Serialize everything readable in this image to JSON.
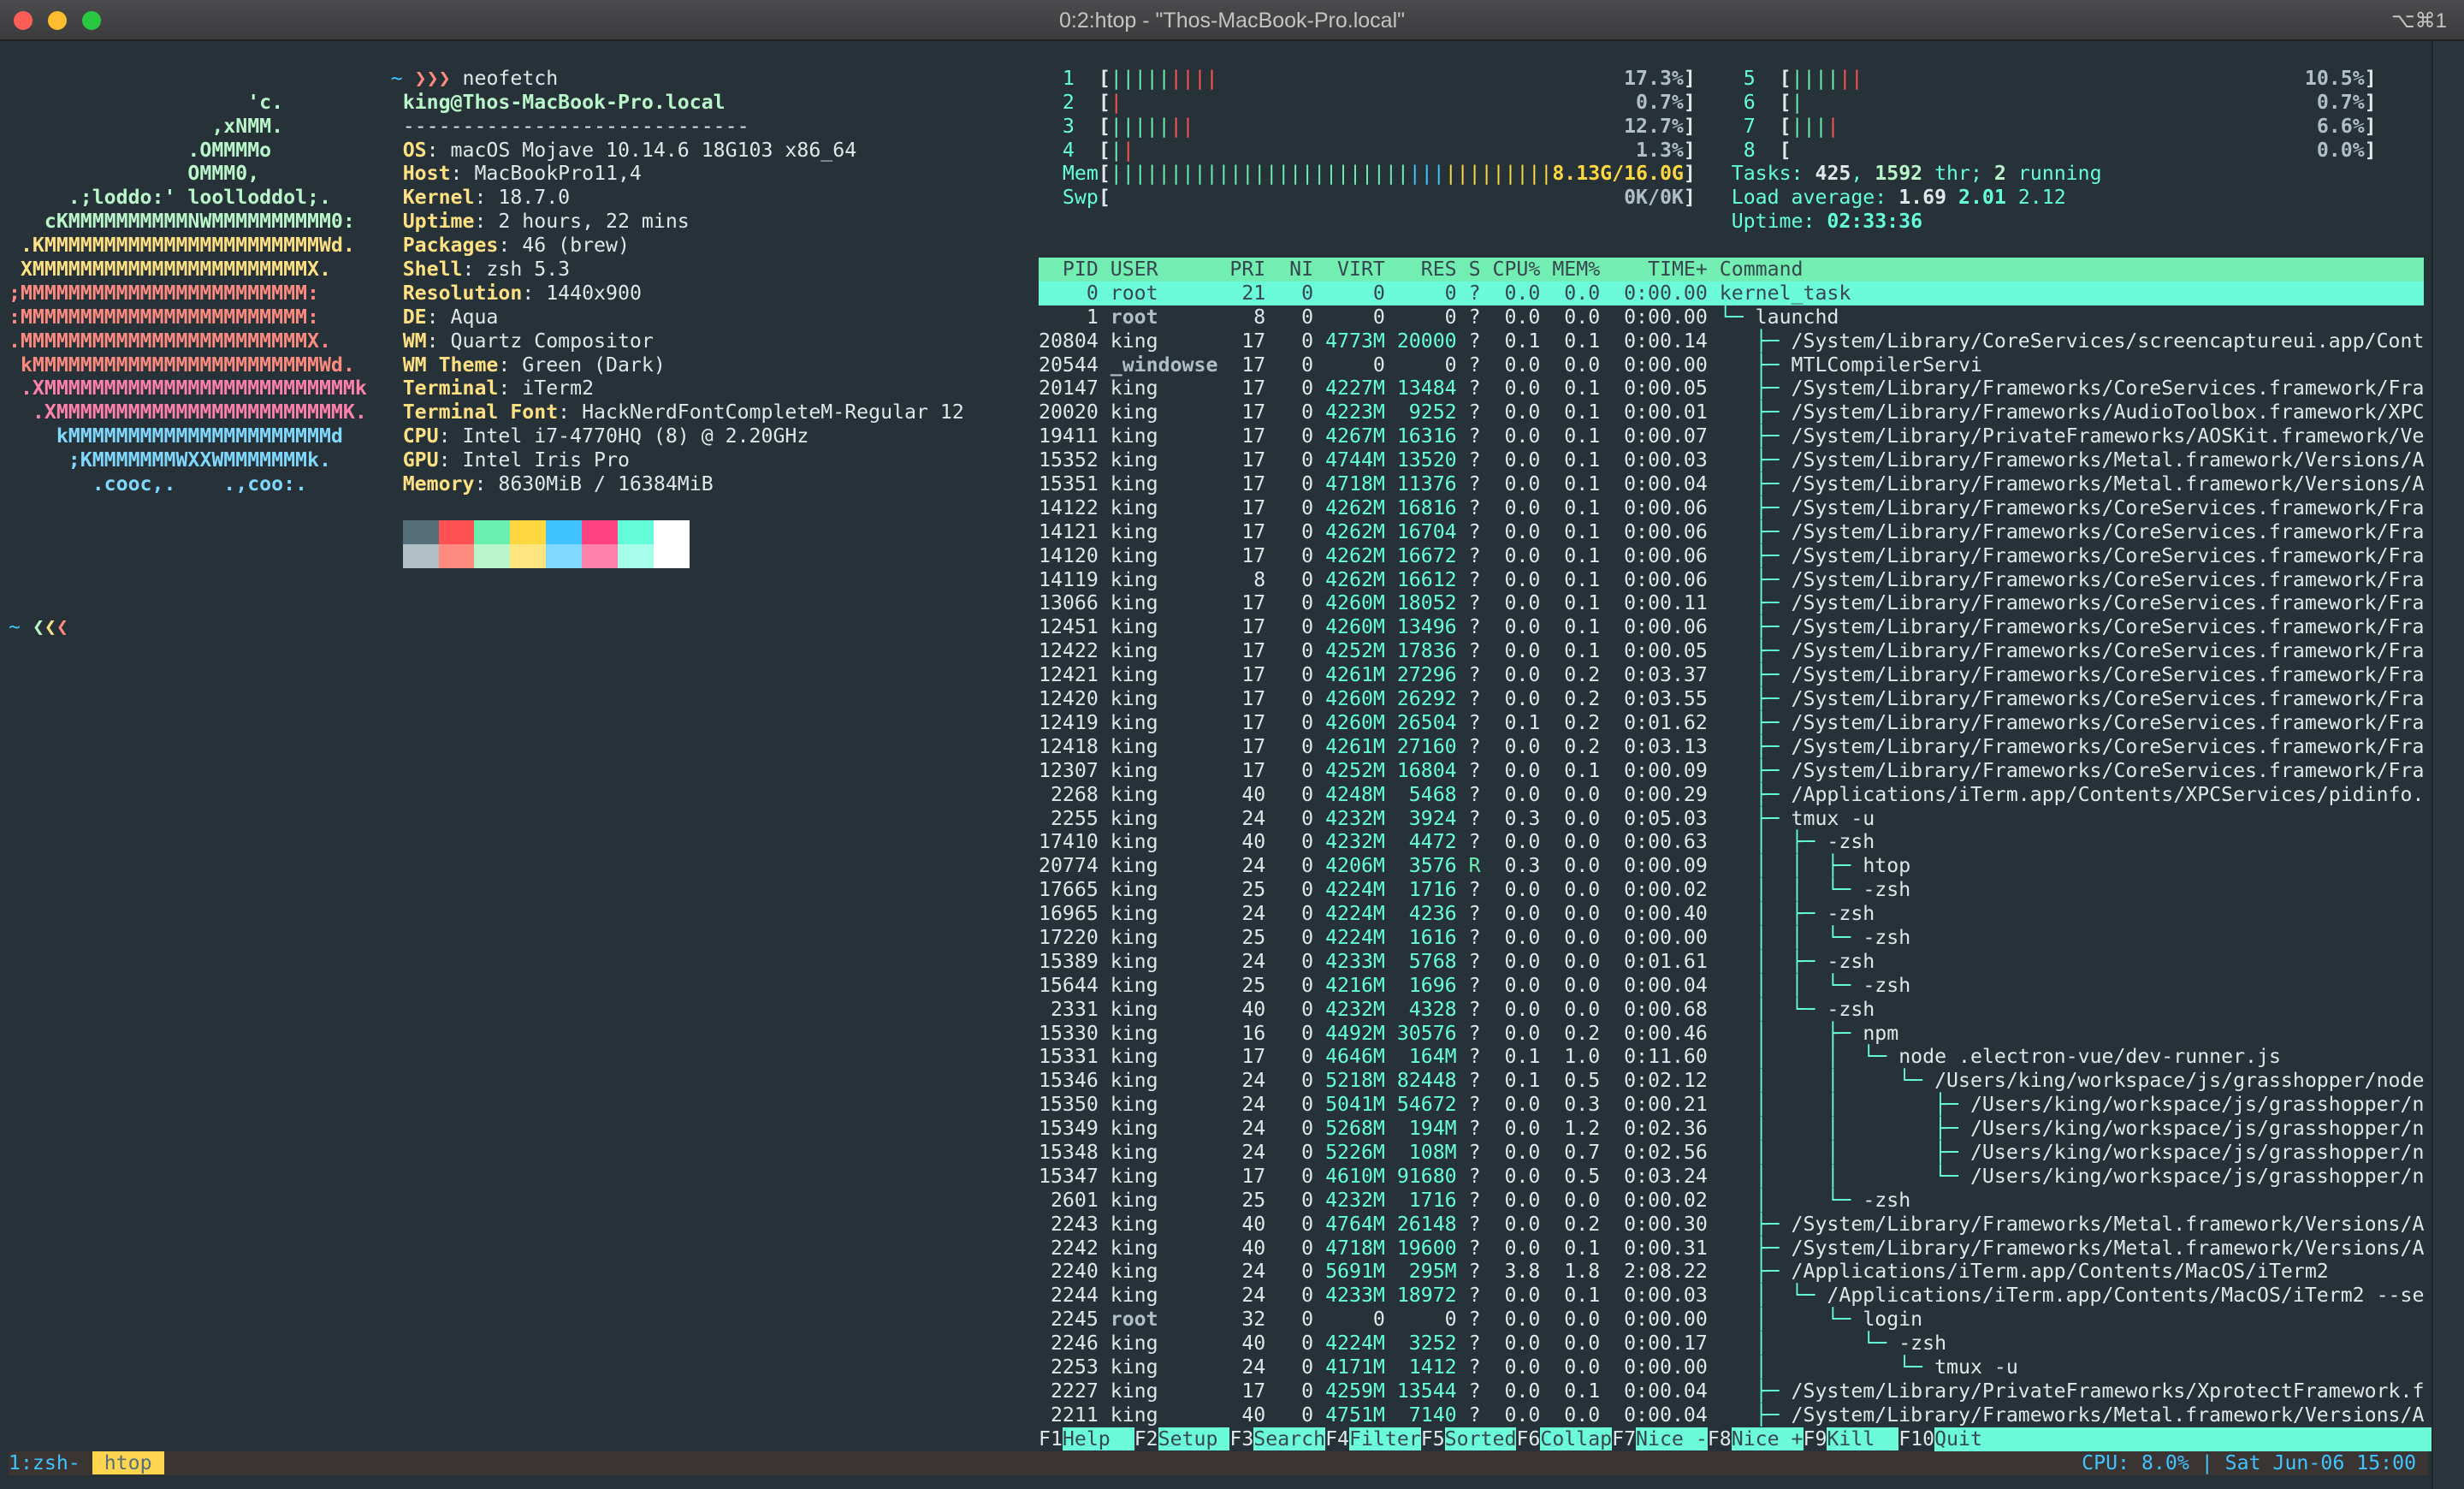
{
  "window": {
    "title": "0:2:htop - \"Thos-MacBook-Pro.local\"",
    "shortcut": "⌥⌘1",
    "traffic_lights": {
      "close": "#fd5f57",
      "minimize": "#febc2e",
      "zoom": "#28c840"
    }
  },
  "colors": {
    "background": "#263238",
    "text": "#e0e6ea",
    "teal": "#64ffda",
    "green": "#69f0ae",
    "red": "#ff5252",
    "blue": "#40c4ff",
    "yellow": "#ffd740",
    "grey": "#b0bec5",
    "header_bg": "#73eeb2",
    "selected_bg": "#6bfbd8",
    "selected_fg": "#37474f",
    "status_bg": "#3a3532",
    "label_yellow": "#ffe082",
    "host_green": "#b9f6ca"
  },
  "neofetch": {
    "prompt_tilde": "~",
    "prompt_arrows": "❯❯❯",
    "command": "neofetch",
    "user_host": "king@Thos-MacBook-Pro.local",
    "separator": "-----------------------------",
    "ascii": [
      {
        "text": "                    'c.",
        "color": "#b9f6ca"
      },
      {
        "text": "                 ,xNMM.",
        "color": "#b9f6ca"
      },
      {
        "text": "               .OMMMMo",
        "color": "#b9f6ca"
      },
      {
        "text": "               OMMM0,",
        "color": "#b9f6ca"
      },
      {
        "text": "     .;loddo:' loolloddol;.",
        "color": "#b9f6ca"
      },
      {
        "text": "   cKMMMMMMMMMMNWMMMMMMMMMM0:",
        "color": "#b9f6ca"
      },
      {
        "text": " .KMMMMMMMMMMMMMMMMMMMMMMMWd.",
        "color": "#ffe082"
      },
      {
        "text": " XMMMMMMMMMMMMMMMMMMMMMMMX.",
        "color": "#ffe082"
      },
      {
        "text": ";MMMMMMMMMMMMMMMMMMMMMMMM:",
        "color": "#ff8a80"
      },
      {
        "text": ":MMMMMMMMMMMMMMMMMMMMMMMM:",
        "color": "#ff8a80"
      },
      {
        "text": ".MMMMMMMMMMMMMMMMMMMMMMMMX.",
        "color": "#ff8a80"
      },
      {
        "text": " kMMMMMMMMMMMMMMMMMMMMMMMMWd.",
        "color": "#ff8a80"
      },
      {
        "text": " .XMMMMMMMMMMMMMMMMMMMMMMMMMMk",
        "color": "#ff80ab"
      },
      {
        "text": "  .XMMMMMMMMMMMMMMMMMMMMMMMMK.",
        "color": "#ff80ab"
      },
      {
        "text": "    kMMMMMMMMMMMMMMMMMMMMMMd",
        "color": "#80d8ff"
      },
      {
        "text": "     ;KMMMMMMMWXXWMMMMMMMk.",
        "color": "#80d8ff"
      },
      {
        "text": "       .cooc,.    .,coo:.",
        "color": "#80d8ff"
      }
    ],
    "info": [
      {
        "label": "OS",
        "value": "macOS Mojave 10.14.6 18G103 x86_64"
      },
      {
        "label": "Host",
        "value": "MacBookPro11,4"
      },
      {
        "label": "Kernel",
        "value": "18.7.0"
      },
      {
        "label": "Uptime",
        "value": "2 hours, 22 mins"
      },
      {
        "label": "Packages",
        "value": "46 (brew)"
      },
      {
        "label": "Shell",
        "value": "zsh 5.3"
      },
      {
        "label": "Resolution",
        "value": "1440x900"
      },
      {
        "label": "DE",
        "value": "Aqua"
      },
      {
        "label": "WM",
        "value": "Quartz Compositor"
      },
      {
        "label": "WM Theme",
        "value": "Green (Dark)"
      },
      {
        "label": "Terminal",
        "value": "iTerm2"
      },
      {
        "label": "Terminal Font",
        "value": "HackNerdFontCompleteM-Regular 12"
      },
      {
        "label": "CPU",
        "value": "Intel i7-4770HQ (8) @ 2.20GHz"
      },
      {
        "label": "GPU",
        "value": "Intel Iris Pro"
      },
      {
        "label": "Memory",
        "value": "8630MiB / 16384MiB"
      }
    ],
    "swatches_top": [
      "#546e7a",
      "#ff5252",
      "#69f0ae",
      "#ffd740",
      "#40c4ff",
      "#ff4081",
      "#64ffda",
      "#ffffff"
    ],
    "swatches_bottom": [
      "#b0bec5",
      "#ff8a80",
      "#b9f6ca",
      "#ffe57f",
      "#80d8ff",
      "#ff80ab",
      "#a7ffeb",
      "#ffffff"
    ],
    "second_prompt_tilde": "~",
    "second_prompt_arrows": [
      {
        "char": "❮",
        "color": "#b9f6ca"
      },
      {
        "char": "❮",
        "color": "#ffe082"
      },
      {
        "char": "❮",
        "color": "#ff8a80"
      }
    ]
  },
  "htop": {
    "cpus": [
      {
        "label": "1",
        "green": "|||||",
        "red": "||||",
        "value": "17.3%"
      },
      {
        "label": "2",
        "green": "",
        "red": "|",
        "value": "0.7%"
      },
      {
        "label": "3",
        "green": "|||||",
        "red": "||",
        "value": "12.7%"
      },
      {
        "label": "4",
        "green": "|",
        "red": "|",
        "value": "1.3%"
      },
      {
        "label": "5",
        "green": "||||",
        "red": "||",
        "value": "10.5%"
      },
      {
        "label": "6",
        "green": "|",
        "red": "",
        "value": "0.7%"
      },
      {
        "label": "7",
        "green": "|||",
        "red": "|",
        "value": "6.6%"
      },
      {
        "label": "8",
        "green": "",
        "red": "",
        "value": "0.0%"
      }
    ],
    "mem": {
      "label": "Mem",
      "green": "|||||||||||||||||||||||||",
      "blue": "|||",
      "yellow": "|||||||||",
      "value": "8.13G/16.0G"
    },
    "swp": {
      "label": "Swp",
      "value": "0K/0K"
    },
    "tasks": {
      "label": "Tasks: ",
      "count": "425",
      "sep": ", ",
      "threads": "1592",
      "thr_label": " thr; ",
      "running": "2",
      "running_label": " running"
    },
    "load": {
      "label": "Load average: ",
      "one": "1.69",
      "five": "2.01",
      "fifteen": "2.12"
    },
    "uptime": {
      "label": "Uptime: ",
      "value": "02:33:36"
    },
    "columns": [
      "PID",
      "USER",
      "PRI",
      "NI",
      "VIRT",
      "RES",
      "S",
      "CPU%",
      "MEM%",
      "TIME+",
      "Command"
    ],
    "selected_pid": "0",
    "processes": [
      [
        "0",
        "root",
        "21",
        "0",
        "0",
        "0",
        "?",
        "0.0",
        "0.0",
        "0:00.00",
        "",
        "kernel_task"
      ],
      [
        "1",
        "root",
        "8",
        "0",
        "0",
        "0",
        "?",
        "0.0",
        "0.0",
        "0:00.00",
        "└─ ",
        "launchd"
      ],
      [
        "20804",
        "king",
        "17",
        "0",
        "4773M",
        "20000",
        "?",
        "0.1",
        "0.1",
        "0:00.14",
        "   ├─ ",
        "/System/Library/CoreServices/screencaptureui.app/Cont"
      ],
      [
        "20544",
        "_windowse",
        "17",
        "0",
        "0",
        "0",
        "?",
        "0.0",
        "0.0",
        "0:00.00",
        "   ├─ ",
        "MTLCompilerServi"
      ],
      [
        "20147",
        "king",
        "17",
        "0",
        "4227M",
        "13484",
        "?",
        "0.0",
        "0.1",
        "0:00.05",
        "   ├─ ",
        "/System/Library/Frameworks/CoreServices.framework/Fra"
      ],
      [
        "20020",
        "king",
        "17",
        "0",
        "4223M",
        "9252",
        "?",
        "0.0",
        "0.1",
        "0:00.01",
        "   ├─ ",
        "/System/Library/Frameworks/AudioToolbox.framework/XPC"
      ],
      [
        "19411",
        "king",
        "17",
        "0",
        "4267M",
        "16316",
        "?",
        "0.0",
        "0.1",
        "0:00.07",
        "   ├─ ",
        "/System/Library/PrivateFrameworks/AOSKit.framework/Ve"
      ],
      [
        "15352",
        "king",
        "17",
        "0",
        "4744M",
        "13520",
        "?",
        "0.0",
        "0.1",
        "0:00.03",
        "   ├─ ",
        "/System/Library/Frameworks/Metal.framework/Versions/A"
      ],
      [
        "15351",
        "king",
        "17",
        "0",
        "4718M",
        "11376",
        "?",
        "0.0",
        "0.1",
        "0:00.04",
        "   ├─ ",
        "/System/Library/Frameworks/Metal.framework/Versions/A"
      ],
      [
        "14122",
        "king",
        "17",
        "0",
        "4262M",
        "16816",
        "?",
        "0.0",
        "0.1",
        "0:00.06",
        "   ├─ ",
        "/System/Library/Frameworks/CoreServices.framework/Fra"
      ],
      [
        "14121",
        "king",
        "17",
        "0",
        "4262M",
        "16704",
        "?",
        "0.0",
        "0.1",
        "0:00.06",
        "   ├─ ",
        "/System/Library/Frameworks/CoreServices.framework/Fra"
      ],
      [
        "14120",
        "king",
        "17",
        "0",
        "4262M",
        "16672",
        "?",
        "0.0",
        "0.1",
        "0:00.06",
        "   ├─ ",
        "/System/Library/Frameworks/CoreServices.framework/Fra"
      ],
      [
        "14119",
        "king",
        "8",
        "0",
        "4262M",
        "16612",
        "?",
        "0.0",
        "0.1",
        "0:00.06",
        "   ├─ ",
        "/System/Library/Frameworks/CoreServices.framework/Fra"
      ],
      [
        "13066",
        "king",
        "17",
        "0",
        "4260M",
        "18052",
        "?",
        "0.0",
        "0.1",
        "0:00.11",
        "   ├─ ",
        "/System/Library/Frameworks/CoreServices.framework/Fra"
      ],
      [
        "12451",
        "king",
        "17",
        "0",
        "4260M",
        "13496",
        "?",
        "0.0",
        "0.1",
        "0:00.06",
        "   ├─ ",
        "/System/Library/Frameworks/CoreServices.framework/Fra"
      ],
      [
        "12422",
        "king",
        "17",
        "0",
        "4252M",
        "17836",
        "?",
        "0.0",
        "0.1",
        "0:00.05",
        "   ├─ ",
        "/System/Library/Frameworks/CoreServices.framework/Fra"
      ],
      [
        "12421",
        "king",
        "17",
        "0",
        "4261M",
        "27296",
        "?",
        "0.0",
        "0.2",
        "0:03.37",
        "   ├─ ",
        "/System/Library/Frameworks/CoreServices.framework/Fra"
      ],
      [
        "12420",
        "king",
        "17",
        "0",
        "4260M",
        "26292",
        "?",
        "0.0",
        "0.2",
        "0:03.55",
        "   ├─ ",
        "/System/Library/Frameworks/CoreServices.framework/Fra"
      ],
      [
        "12419",
        "king",
        "17",
        "0",
        "4260M",
        "26504",
        "?",
        "0.1",
        "0.2",
        "0:01.62",
        "   ├─ ",
        "/System/Library/Frameworks/CoreServices.framework/Fra"
      ],
      [
        "12418",
        "king",
        "17",
        "0",
        "4261M",
        "27160",
        "?",
        "0.0",
        "0.2",
        "0:03.13",
        "   ├─ ",
        "/System/Library/Frameworks/CoreServices.framework/Fra"
      ],
      [
        "12307",
        "king",
        "17",
        "0",
        "4252M",
        "16804",
        "?",
        "0.0",
        "0.1",
        "0:00.09",
        "   ├─ ",
        "/System/Library/Frameworks/CoreServices.framework/Fra"
      ],
      [
        "2268",
        "king",
        "40",
        "0",
        "4248M",
        "5468",
        "?",
        "0.0",
        "0.0",
        "0:00.29",
        "   ├─ ",
        "/Applications/iTerm.app/Contents/XPCServices/pidinfo."
      ],
      [
        "2255",
        "king",
        "24",
        "0",
        "4232M",
        "3924",
        "?",
        "0.3",
        "0.0",
        "0:05.03",
        "   ├─ ",
        "tmux -u"
      ],
      [
        "17410",
        "king",
        "40",
        "0",
        "4232M",
        "4472",
        "?",
        "0.0",
        "0.0",
        "0:00.63",
        "   │  ├─ ",
        "-zsh"
      ],
      [
        "20774",
        "king",
        "24",
        "0",
        "4206M",
        "3576",
        "R",
        "0.3",
        "0.0",
        "0:00.09",
        "   │  │  ├─ ",
        "htop"
      ],
      [
        "17665",
        "king",
        "25",
        "0",
        "4224M",
        "1716",
        "?",
        "0.0",
        "0.0",
        "0:00.02",
        "   │  │  └─ ",
        "-zsh"
      ],
      [
        "16965",
        "king",
        "24",
        "0",
        "4224M",
        "4236",
        "?",
        "0.0",
        "0.0",
        "0:00.40",
        "   │  ├─ ",
        "-zsh"
      ],
      [
        "17220",
        "king",
        "25",
        "0",
        "4224M",
        "1616",
        "?",
        "0.0",
        "0.0",
        "0:00.00",
        "   │  │  └─ ",
        "-zsh"
      ],
      [
        "15389",
        "king",
        "24",
        "0",
        "4233M",
        "5768",
        "?",
        "0.0",
        "0.0",
        "0:01.61",
        "   │  ├─ ",
        "-zsh"
      ],
      [
        "15644",
        "king",
        "25",
        "0",
        "4216M",
        "1696",
        "?",
        "0.0",
        "0.0",
        "0:00.04",
        "   │  │  └─ ",
        "-zsh"
      ],
      [
        "2331",
        "king",
        "40",
        "0",
        "4232M",
        "4328",
        "?",
        "0.0",
        "0.0",
        "0:00.68",
        "   │  └─ ",
        "-zsh"
      ],
      [
        "15330",
        "king",
        "16",
        "0",
        "4492M",
        "30576",
        "?",
        "0.0",
        "0.2",
        "0:00.46",
        "   │     ├─ ",
        "npm"
      ],
      [
        "15331",
        "king",
        "17",
        "0",
        "4646M",
        "164M",
        "?",
        "0.1",
        "1.0",
        "0:11.60",
        "   │     │  └─ ",
        "node .electron-vue/dev-runner.js"
      ],
      [
        "15346",
        "king",
        "24",
        "0",
        "5218M",
        "82448",
        "?",
        "0.1",
        "0.5",
        "0:02.12",
        "   │     │     └─ ",
        "/Users/king/workspace/js/grasshopper/node"
      ],
      [
        "15350",
        "king",
        "24",
        "0",
        "5041M",
        "54672",
        "?",
        "0.0",
        "0.3",
        "0:00.21",
        "   │     │        ├─ ",
        "/Users/king/workspace/js/grasshopper/n"
      ],
      [
        "15349",
        "king",
        "24",
        "0",
        "5268M",
        "194M",
        "?",
        "0.0",
        "1.2",
        "0:02.36",
        "   │     │        ├─ ",
        "/Users/king/workspace/js/grasshopper/n"
      ],
      [
        "15348",
        "king",
        "24",
        "0",
        "5226M",
        "108M",
        "?",
        "0.0",
        "0.7",
        "0:02.56",
        "   │     │        ├─ ",
        "/Users/king/workspace/js/grasshopper/n"
      ],
      [
        "15347",
        "king",
        "17",
        "0",
        "4610M",
        "91680",
        "?",
        "0.0",
        "0.5",
        "0:03.24",
        "   │     │        └─ ",
        "/Users/king/workspace/js/grasshopper/n"
      ],
      [
        "2601",
        "king",
        "25",
        "0",
        "4232M",
        "1716",
        "?",
        "0.0",
        "0.0",
        "0:00.02",
        "   │     └─ ",
        "-zsh"
      ],
      [
        "2243",
        "king",
        "40",
        "0",
        "4764M",
        "26148",
        "?",
        "0.0",
        "0.2",
        "0:00.30",
        "   ├─ ",
        "/System/Library/Frameworks/Metal.framework/Versions/A"
      ],
      [
        "2242",
        "king",
        "40",
        "0",
        "4718M",
        "19600",
        "?",
        "0.0",
        "0.1",
        "0:00.31",
        "   ├─ ",
        "/System/Library/Frameworks/Metal.framework/Versions/A"
      ],
      [
        "2240",
        "king",
        "24",
        "0",
        "5691M",
        "295M",
        "?",
        "3.8",
        "1.8",
        "2:08.22",
        "   ├─ ",
        "/Applications/iTerm.app/Contents/MacOS/iTerm2"
      ],
      [
        "2244",
        "king",
        "24",
        "0",
        "4233M",
        "18972",
        "?",
        "0.0",
        "0.1",
        "0:00.03",
        "   │  └─ ",
        "/Applications/iTerm.app/Contents/MacOS/iTerm2 --se"
      ],
      [
        "2245",
        "root",
        "32",
        "0",
        "0",
        "0",
        "?",
        "0.0",
        "0.0",
        "0:00.00",
        "   │     └─ ",
        "login"
      ],
      [
        "2246",
        "king",
        "40",
        "0",
        "4224M",
        "3252",
        "?",
        "0.0",
        "0.0",
        "0:00.17",
        "   │        └─ ",
        "-zsh"
      ],
      [
        "2253",
        "king",
        "24",
        "0",
        "4171M",
        "1412",
        "?",
        "0.0",
        "0.0",
        "0:00.00",
        "   │           └─ ",
        "tmux -u"
      ],
      [
        "2227",
        "king",
        "17",
        "0",
        "4259M",
        "13544",
        "?",
        "0.0",
        "0.1",
        "0:00.04",
        "   ├─ ",
        "/System/Library/PrivateFrameworks/XprotectFramework.f"
      ],
      [
        "2211",
        "king",
        "40",
        "0",
        "4751M",
        "7140",
        "?",
        "0.0",
        "0.0",
        "0:00.04",
        "   ├─ ",
        "/System/Library/Frameworks/Metal.framework/Versions/A"
      ]
    ],
    "function_keys": [
      {
        "key": "F1",
        "label": "Help  "
      },
      {
        "key": "F2",
        "label": "Setup "
      },
      {
        "key": "F3",
        "label": "Search"
      },
      {
        "key": "F4",
        "label": "Filter"
      },
      {
        "key": "F5",
        "label": "Sorted"
      },
      {
        "key": "F6",
        "label": "Collap"
      },
      {
        "key": "F7",
        "label": "Nice -"
      },
      {
        "key": "F8",
        "label": "Nice +"
      },
      {
        "key": "F9",
        "label": "Kill  "
      },
      {
        "key": "F10",
        "label": "Quit"
      }
    ]
  },
  "tmux_status": {
    "window_inactive": "1:zsh-",
    "window_active": " htop ",
    "right": "CPU: 8.0% | Sat Jun-06 15:00"
  }
}
